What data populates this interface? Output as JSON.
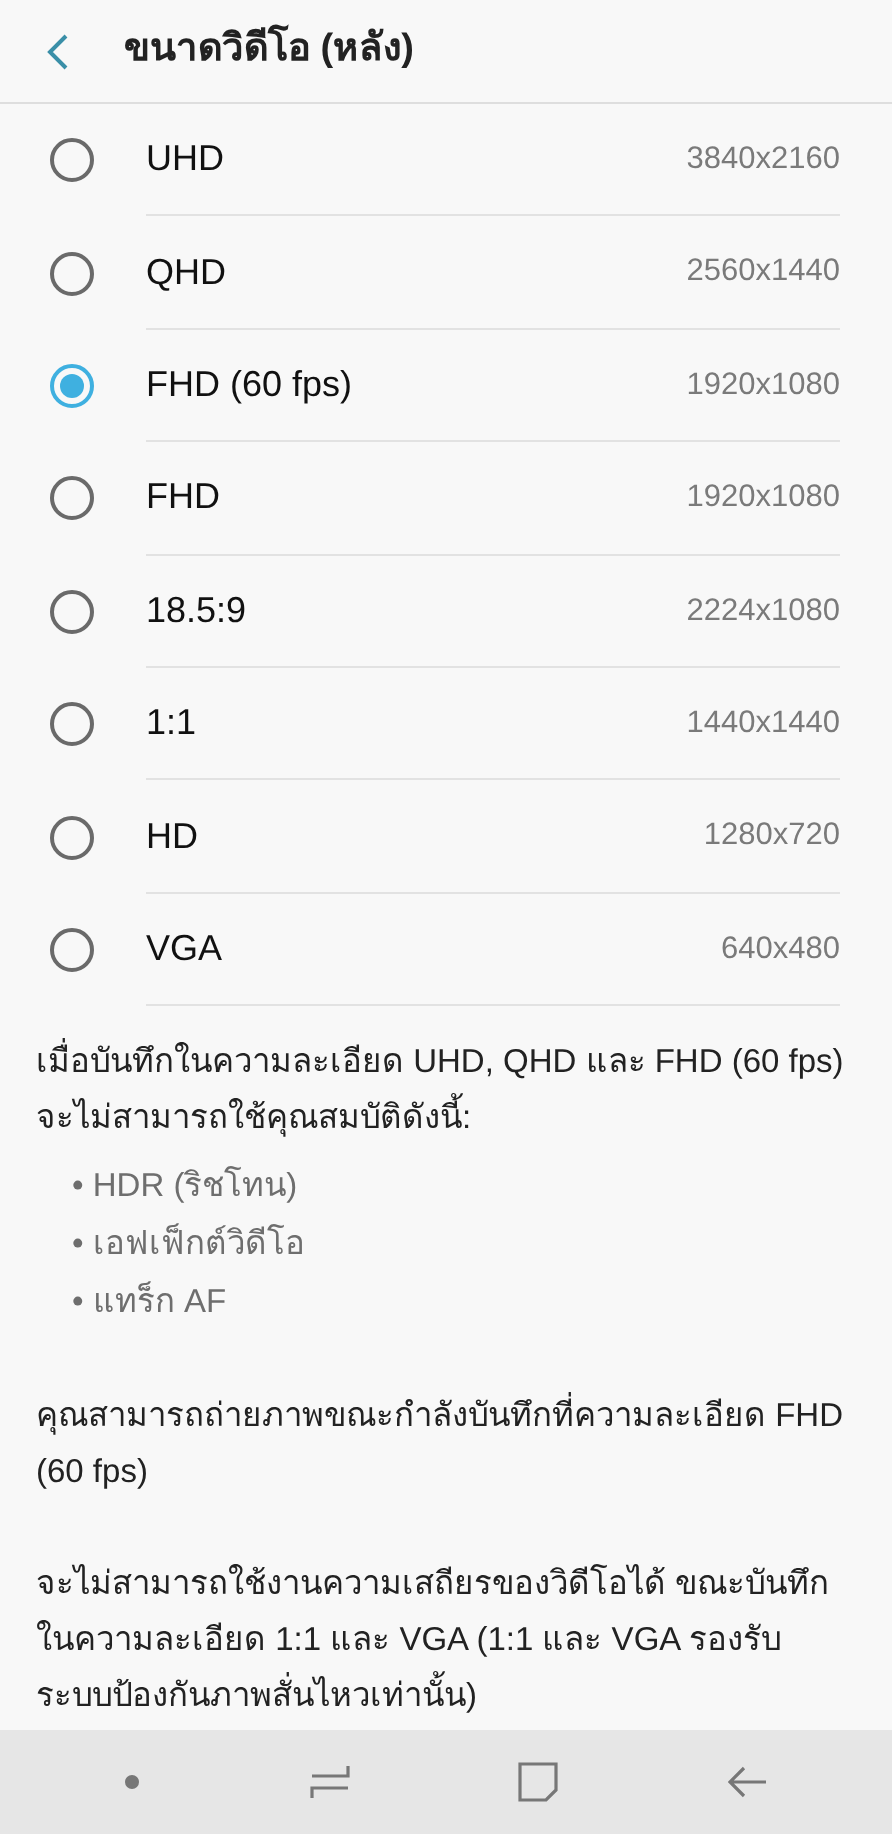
{
  "header": {
    "title": "ขนาดวิดีโอ (หลัง)"
  },
  "options": [
    {
      "label": "UHD",
      "resolution": "3840x2160",
      "selected": false
    },
    {
      "label": "QHD",
      "resolution": "2560x1440",
      "selected": false
    },
    {
      "label": "FHD (60 fps)",
      "resolution": "1920x1080",
      "selected": true
    },
    {
      "label": "FHD",
      "resolution": "1920x1080",
      "selected": false
    },
    {
      "label": "18.5:9",
      "resolution": "2224x1080",
      "selected": false
    },
    {
      "label": "1:1",
      "resolution": "1440x1440",
      "selected": false
    },
    {
      "label": "HD",
      "resolution": "1280x720",
      "selected": false
    },
    {
      "label": "VGA",
      "resolution": "640x480",
      "selected": false
    }
  ],
  "notes": [
    {
      "text": "เมื่อบันทึกในความละเอียด UHD, QHD และ FHD (60 fps) จะไม่สามารถใช้คุณสมบัติดังนี้:",
      "bullets": [
        "• HDR (ริชโทน)",
        "• เอฟเฟ็กต์วิดีโอ",
        "• แทร็ก AF"
      ]
    },
    {
      "text": "คุณสามารถถ่ายภาพขณะกำลังบันทึกที่ความละเอียด FHD (60 fps)"
    },
    {
      "text": "จะไม่สามารถใช้งานความเสถียรของวิดีโอได้ ขณะบันทึกในความละเอียด 1:1 และ VGA (1:1 และ VGA รองรับระบบป้องกันภาพสั่นไหวเท่านั้น)"
    }
  ]
}
